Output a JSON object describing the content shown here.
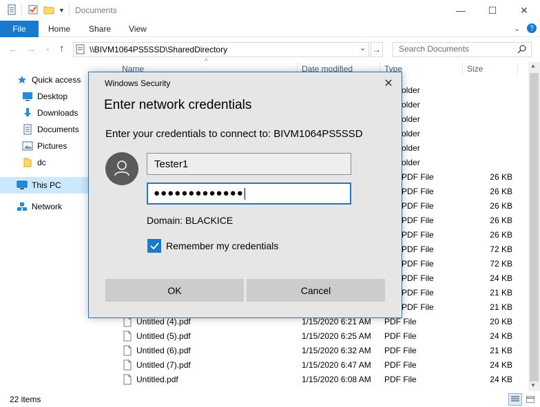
{
  "window": {
    "title": "Documents",
    "minimize_glyph": "—",
    "maximize_glyph": "☐",
    "close_glyph": "✕"
  },
  "ribbon": {
    "tabs": [
      "File",
      "Home",
      "Share",
      "View"
    ]
  },
  "address": {
    "path": "\\\\BIVM1064PS5SSD\\SharedDirectory",
    "search_placeholder": "Search Documents"
  },
  "nav": {
    "items": [
      {
        "label": "Quick access",
        "icon": "star-icon"
      },
      {
        "label": "Desktop",
        "icon": "desktop-icon"
      },
      {
        "label": "Downloads",
        "icon": "download-icon"
      },
      {
        "label": "Documents",
        "icon": "documents-icon"
      },
      {
        "label": "Pictures",
        "icon": "pictures-icon"
      },
      {
        "label": "dc",
        "icon": "folder-icon"
      },
      {
        "label": "This PC",
        "icon": "computer-icon"
      },
      {
        "label": "Network",
        "icon": "network-icon"
      }
    ]
  },
  "columns": {
    "name": "Name",
    "date": "Date modified",
    "type": "Type",
    "size": "Size"
  },
  "files": [
    {
      "name": "",
      "date": "",
      "type": "older",
      "size": ""
    },
    {
      "name": "",
      "date": "",
      "type": "older",
      "size": ""
    },
    {
      "name": "",
      "date": "",
      "type": "older",
      "size": ""
    },
    {
      "name": "",
      "date": "",
      "type": "older",
      "size": ""
    },
    {
      "name": "",
      "date": "",
      "type": "older",
      "size": ""
    },
    {
      "name": "",
      "date": "",
      "type": "older",
      "size": ""
    },
    {
      "name": "",
      "date": "",
      "type": "PDF File",
      "size": "26 KB"
    },
    {
      "name": "",
      "date": "",
      "type": "PDF File",
      "size": "26 KB"
    },
    {
      "name": "",
      "date": "",
      "type": "PDF File",
      "size": "26 KB"
    },
    {
      "name": "",
      "date": "",
      "type": "PDF File",
      "size": "26 KB"
    },
    {
      "name": "",
      "date": "",
      "type": "PDF File",
      "size": "26 KB"
    },
    {
      "name": "",
      "date": "",
      "type": "PDF File",
      "size": "72 KB"
    },
    {
      "name": "",
      "date": "",
      "type": "PDF File",
      "size": "72 KB"
    },
    {
      "name": "",
      "date": "",
      "type": "PDF File",
      "size": "24 KB"
    },
    {
      "name": "",
      "date": "",
      "type": "PDF File",
      "size": "21 KB"
    },
    {
      "name": "",
      "date": "",
      "type": "PDF File",
      "size": "21 KB"
    },
    {
      "name": "Untitled (4).pdf",
      "date": "1/15/2020 6:21 AM",
      "type": "PDF File",
      "size": "20 KB"
    },
    {
      "name": "Untitled (5).pdf",
      "date": "1/15/2020 6:25 AM",
      "type": "PDF File",
      "size": "24 KB"
    },
    {
      "name": "Untitled (6).pdf",
      "date": "1/15/2020 6:32 AM",
      "type": "PDF File",
      "size": "21 KB"
    },
    {
      "name": "Untitled (7).pdf",
      "date": "1/15/2020 6:47 AM",
      "type": "PDF File",
      "size": "24 KB"
    },
    {
      "name": "Untitled.pdf",
      "date": "1/15/2020 6:08 AM",
      "type": "PDF File",
      "size": "24 KB"
    }
  ],
  "status": {
    "items_count": "22 items"
  },
  "dialog": {
    "caption": "Windows Security",
    "heading": "Enter network credentials",
    "prompt": "Enter your credentials to connect to: BIVM1064PS5SSD",
    "username_value": "Tester1",
    "password_value": "●●●●●●●●●●●●●",
    "domain": "Domain: BLACKICE",
    "remember_label": "Remember my credentials",
    "remember_checked": true,
    "ok_label": "OK",
    "cancel_label": "Cancel",
    "close_glyph": "✕"
  },
  "colors": {
    "accent": "#1979ca",
    "selection": "#cce8ff",
    "dialog_bg": "#e6e6e6"
  }
}
